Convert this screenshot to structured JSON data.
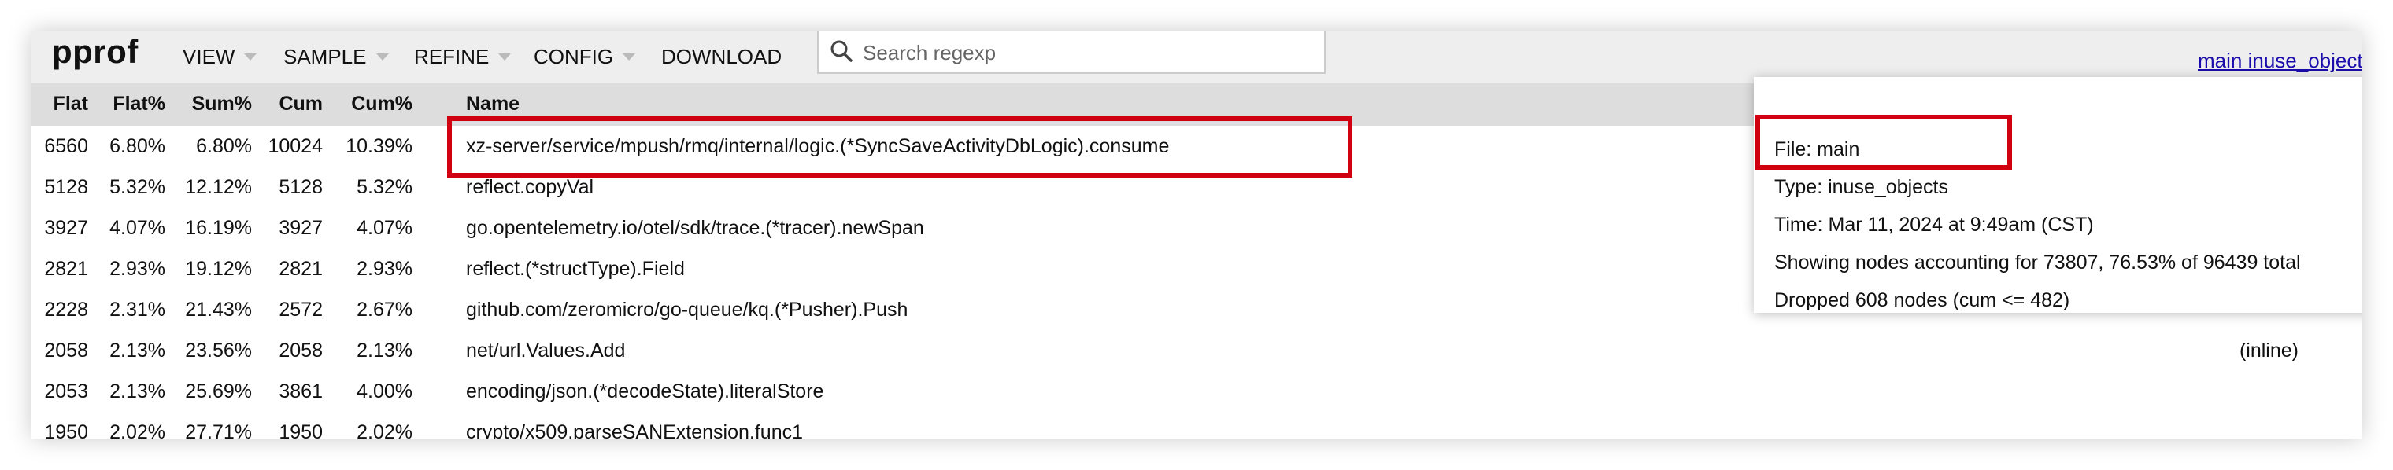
{
  "app": {
    "logo": "pprof",
    "menu": [
      {
        "label": "VIEW",
        "dropdown": true
      },
      {
        "label": "SAMPLE",
        "dropdown": true
      },
      {
        "label": "REFINE",
        "dropdown": true
      },
      {
        "label": "CONFIG",
        "dropdown": true
      },
      {
        "label": "DOWNLOAD",
        "dropdown": false
      }
    ],
    "search": {
      "placeholder": "Search regexp",
      "value": ""
    },
    "title_link": "main inuse_objects"
  },
  "table": {
    "columns": [
      "Flat",
      "Flat%",
      "Sum%",
      "Cum",
      "Cum%",
      "Name"
    ],
    "rows": [
      {
        "flat": "6560",
        "flat_pct": "6.80%",
        "sum_pct": "6.80%",
        "cum": "10024",
        "cum_pct": "10.39%",
        "name": "xz-server/service/mpush/rmq/internal/logic.(*SyncSaveActivityDbLogic).consume",
        "note": ""
      },
      {
        "flat": "5128",
        "flat_pct": "5.32%",
        "sum_pct": "12.12%",
        "cum": "5128",
        "cum_pct": "5.32%",
        "name": "reflect.copyVal",
        "note": ""
      },
      {
        "flat": "3927",
        "flat_pct": "4.07%",
        "sum_pct": "16.19%",
        "cum": "3927",
        "cum_pct": "4.07%",
        "name": "go.opentelemetry.io/otel/sdk/trace.(*tracer).newSpan",
        "note": ""
      },
      {
        "flat": "2821",
        "flat_pct": "2.93%",
        "sum_pct": "19.12%",
        "cum": "2821",
        "cum_pct": "2.93%",
        "name": "reflect.(*structType).Field",
        "note": ""
      },
      {
        "flat": "2228",
        "flat_pct": "2.31%",
        "sum_pct": "21.43%",
        "cum": "2572",
        "cum_pct": "2.67%",
        "name": "github.com/zeromicro/go-queue/kq.(*Pusher).Push",
        "note": ""
      },
      {
        "flat": "2058",
        "flat_pct": "2.13%",
        "sum_pct": "23.56%",
        "cum": "2058",
        "cum_pct": "2.13%",
        "name": "net/url.Values.Add",
        "note": "(inline)"
      },
      {
        "flat": "2053",
        "flat_pct": "2.13%",
        "sum_pct": "25.69%",
        "cum": "3861",
        "cum_pct": "4.00%",
        "name": "encoding/json.(*decodeState).literalStore",
        "note": ""
      },
      {
        "flat": "1950",
        "flat_pct": "2.02%",
        "sum_pct": "27.71%",
        "cum": "1950",
        "cum_pct": "2.02%",
        "name": "crypto/x509.parseSANExtension.func1",
        "note": ""
      }
    ]
  },
  "info": {
    "file": "File: main",
    "type": "Type: inuse_objects",
    "time": "Time: Mar 11, 2024 at 9:49am (CST)",
    "showing": "Showing nodes accounting for 73807, 76.53% of 96439 total",
    "dropped": "Dropped 608 nodes (cum <= 482)"
  },
  "colors": {
    "header_bg": "#eeeeee",
    "table_header_bg": "#dddddd",
    "highlight": "#d00010",
    "link": "#1a0dab"
  },
  "icons": {
    "search": "search-icon",
    "menu_caret": "chevron-down-icon"
  }
}
